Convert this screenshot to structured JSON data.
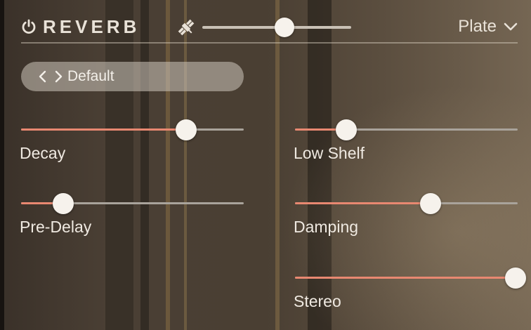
{
  "plugin": {
    "title": "REVERB",
    "type_selected": "Plate",
    "mix_level": 0.55,
    "preset_name": "Default"
  },
  "params": [
    {
      "label": "Decay",
      "value": 0.74
    },
    {
      "label": "Low Shelf",
      "value": 0.23
    },
    {
      "label": "Pre-Delay",
      "value": 0.19
    },
    {
      "label": "Damping",
      "value": 0.61
    },
    {
      "label": "Stereo",
      "value": 0.99
    }
  ],
  "colors": {
    "accent": "#e88871",
    "knob": "#f6f2ec",
    "text": "#efe9e1",
    "track": "#a9a39b"
  },
  "icons": [
    "power-icon",
    "satellite-icon",
    "chevron-down-icon",
    "chevron-left-icon",
    "chevron-right-icon"
  ]
}
